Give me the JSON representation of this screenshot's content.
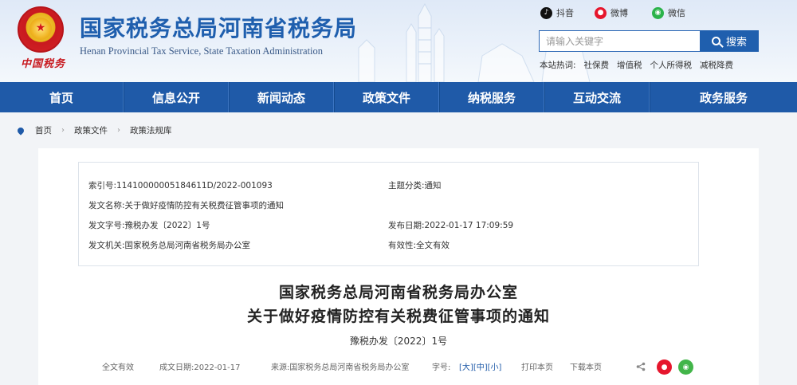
{
  "header": {
    "title": "国家税务总局河南省税务局",
    "subtitle": "Henan Provincial Tax Service, State Taxation Administration",
    "brand_script": "中国税务",
    "social": [
      {
        "label": "抖音",
        "icon": "douyin-icon"
      },
      {
        "label": "微博",
        "icon": "weibo-icon"
      },
      {
        "label": "微信",
        "icon": "wechat-icon"
      }
    ],
    "search": {
      "placeholder": "请输入关键字",
      "button_label": "搜索"
    },
    "hotwords": {
      "label": "本站热词:",
      "items": [
        "社保费",
        "增值税",
        "个人所得税",
        "减税降费"
      ]
    }
  },
  "nav": {
    "items": [
      "首页",
      "信息公开",
      "新闻动态",
      "政策文件",
      "纳税服务",
      "互动交流",
      "政务服务"
    ]
  },
  "breadcrumb": [
    "首页",
    "政策文件",
    "政策法规库"
  ],
  "meta": {
    "index_no": {
      "label": "索引号:",
      "value": "11410000005184611D/2022-001093"
    },
    "topic": {
      "label": "主题分类:",
      "value": "通知"
    },
    "doc_name": {
      "label": "发文名称:",
      "value": "关于做好疫情防控有关税费征管事项的通知"
    },
    "doc_code": {
      "label": "发文字号:",
      "value": "豫税办发〔2022〕1号"
    },
    "publish_date": {
      "label": "发布日期:",
      "value": "2022-01-17 17:09:59"
    },
    "issuer": {
      "label": "发文机关:",
      "value": "国家税务总局河南省税务局办公室"
    },
    "validity": {
      "label": "有效性:",
      "value": "全文有效"
    }
  },
  "document": {
    "title_line1": "国家税务总局河南省税务局办公室",
    "title_line2": "关于做好疫情防控有关税费征管事项的通知",
    "doc_no": "豫税办发〔2022〕1号"
  },
  "info_bar": {
    "validity": "全文有效",
    "date": "成文日期:2022-01-17",
    "source": "来源:国家税务总局河南省税务局办公室",
    "font_label": "字号:",
    "font_sizes": [
      "[大]",
      "[中]",
      "[小]"
    ],
    "print": "打印本页",
    "download": "下载本页"
  }
}
